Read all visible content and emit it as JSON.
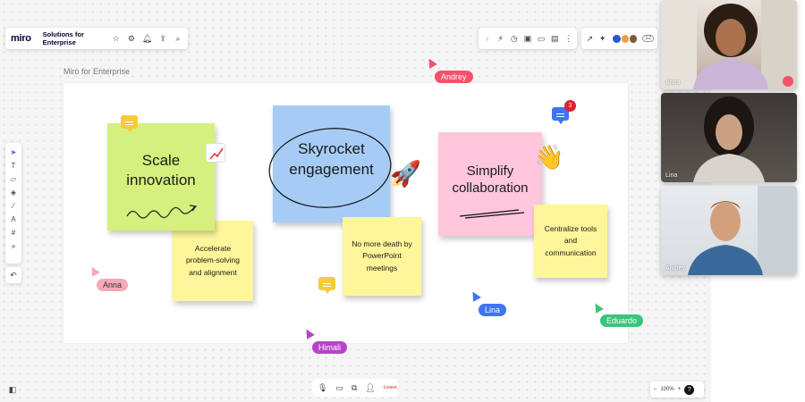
{
  "app": {
    "logo": "miro",
    "board_name": "Solutions for Enterprise"
  },
  "frame": {
    "label": "Miro for Enterprise"
  },
  "stickies": {
    "scale": "Scale innovation",
    "skyrocket": "Skyrocket engagement",
    "simplify": "Simplify collaboration",
    "accelerate": "Accelerate problem-solving and alignment",
    "nomore": "No more death by PowerPoint meetings",
    "centralize": "Centralize tools and communication"
  },
  "cursors": [
    {
      "name": "Andrey",
      "color": "#f2526b"
    },
    {
      "name": "Anna",
      "color": "#f7a8b8"
    },
    {
      "name": "Lina",
      "color": "#3f73f5"
    },
    {
      "name": "Himali",
      "color": "#b544c6"
    },
    {
      "name": "Eduardo",
      "color": "#3cc47a"
    }
  ],
  "comment_badge": "3",
  "participants": {
    "count": "12"
  },
  "videos": [
    {
      "name": "Anna"
    },
    {
      "name": "Lina"
    },
    {
      "name": "Andrey"
    }
  ],
  "call": {
    "leave_label": "Leave"
  },
  "zoom": {
    "level": "100%",
    "help": "?"
  },
  "colors": {
    "yellow": "#fff59a",
    "green": "#d5f07c",
    "blue": "#a6ccf5",
    "pink": "#ffc6dc",
    "brand": "#050038"
  },
  "icons": [
    "star-icon",
    "settings-icon",
    "bell-icon",
    "upload-icon",
    "search-icon",
    "cursor-icon",
    "text-icon",
    "sticky-note-icon",
    "shapes-icon",
    "pen-icon",
    "marker-icon",
    "frame-icon",
    "more-icon",
    "undo-icon",
    "mic-icon",
    "camera-icon",
    "share-screen-icon",
    "add-person-icon",
    "minimap-icon"
  ]
}
